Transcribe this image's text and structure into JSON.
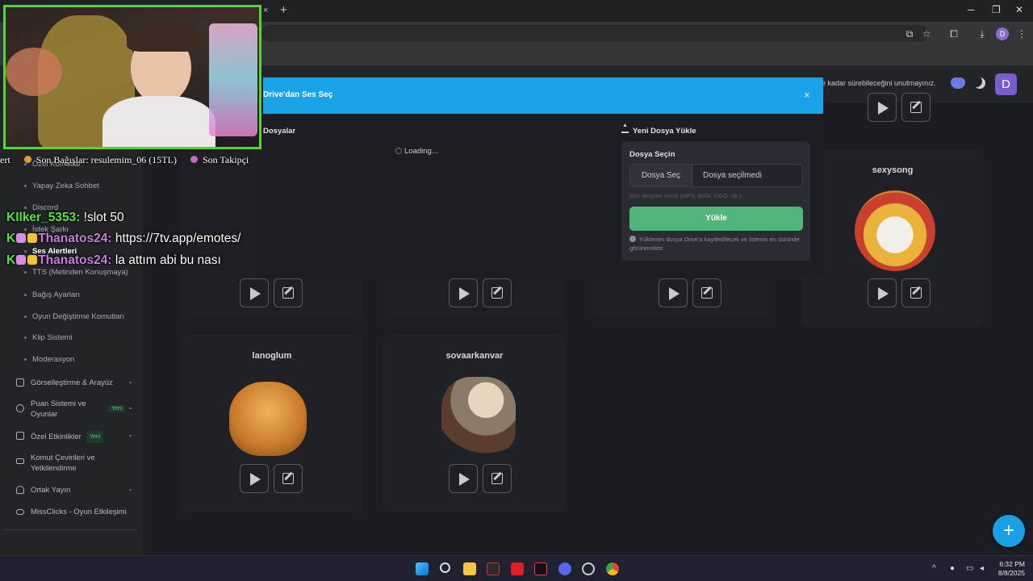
{
  "browser": {
    "tab_close_glyph": "×",
    "new_tab_glyph": "+",
    "window_minimize": "─",
    "window_restore": "❐",
    "window_close": "✕",
    "profile_initial": "D"
  },
  "app_bar": {
    "warning_text": "e kadar sürebileceğini unutmayınız.",
    "user_initial": "D"
  },
  "sidebar": {
    "sub_items": [
      {
        "label": "Özel Komutlar",
        "active": false
      },
      {
        "label": "Yapay Zeka Sohbet",
        "active": false
      },
      {
        "label": "Discord",
        "active": false
      },
      {
        "label": "İstek Şarkı",
        "active": false
      },
      {
        "label": "Ses Alertleri",
        "active": true
      },
      {
        "label": "TTS (Metinden Konuşmaya)",
        "active": false
      },
      {
        "label": "Bağış Ayarları",
        "active": false
      },
      {
        "label": "Oyun Değiştirme Komutları",
        "active": false
      },
      {
        "label": "Klip Sistemi",
        "active": false
      },
      {
        "label": "Moderasyon",
        "active": false
      }
    ],
    "categories": [
      {
        "label": "Görselleştirme & Arayüz",
        "badge": "",
        "chevron": "⌄",
        "icon": "palette-icon"
      },
      {
        "label": "Puan Sistemi ve Oyunlar",
        "badge": "Yeni",
        "chevron": "⌄",
        "icon": "coin-icon"
      },
      {
        "label": "Özel Etkinlikler",
        "badge": "Yeni",
        "chevron": "⌄",
        "icon": "calendar-icon"
      },
      {
        "label": "Komut Çevirileri ve Yetkilendirme",
        "badge": "",
        "chevron": "",
        "icon": "keyboard-icon"
      },
      {
        "label": "Ortak Yayın",
        "badge": "",
        "chevron": "⌄",
        "icon": "users-icon"
      },
      {
        "label": "MissClicks - Oyun Etkileşimi",
        "badge": "",
        "chevron": "",
        "icon": "gamepad-icon"
      }
    ]
  },
  "cards": [
    {
      "title": "sexysong"
    },
    {
      "title": "lanoglum"
    },
    {
      "title": "sovaarkanvar"
    }
  ],
  "modal": {
    "title": "Drive'dan Ses Seç",
    "close_glyph": "×",
    "files_heading": "Dosyalar",
    "loading_text": "Loading...",
    "upload_heading": "Yeni Dosya Yükle",
    "choose_label": "Dosya Seçin",
    "choose_button": "Dosya Seç",
    "no_file_text": "Dosya seçilmedi",
    "format_hint": "Ses dosyası seçin (MP3, WAV, OGG, vb.)",
    "upload_button": "Yükle",
    "upload_info": "Yüklenen dosya Drive'a kaydedilecek ve listenin en üstünde görünecektir."
  },
  "overlay": {
    "ticker_start": "ert",
    "ticker_donations": "Son Bağışlar: resulemim_06 (15TL)",
    "ticker_followers": "Son Takipçi",
    "chat": [
      {
        "user": "Ilker_5353:",
        "message": "!slot 50",
        "user_color": "#57e33e",
        "badges": 0
      },
      {
        "user": "Thanatos24:",
        "message": "https://7tv.app/emotes/",
        "user_color": "#c77ddb",
        "badges": 2
      },
      {
        "user": "Thanatos24:",
        "message": "la attım abi bu nası",
        "user_color": "#c77ddb",
        "badges": 2
      }
    ],
    "chat_k": "K"
  },
  "fab_label": "+",
  "taskbar": {
    "time": "6:32 PM",
    "date": "8/8/2025"
  }
}
